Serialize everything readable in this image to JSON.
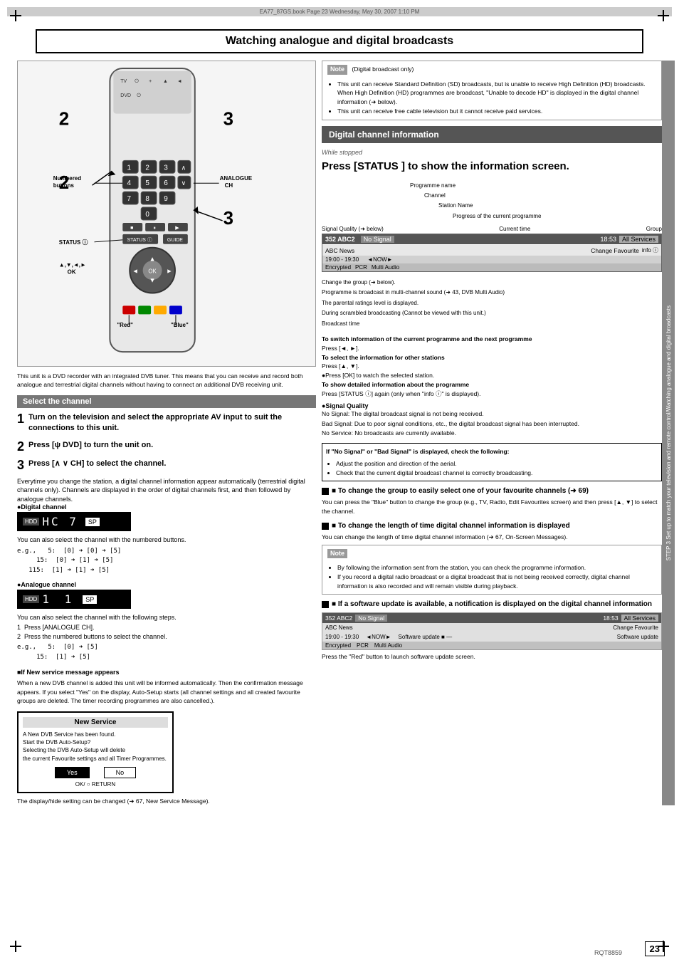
{
  "page": {
    "title": "Watching analogue and digital broadcasts",
    "header_bar": "EA77_87GS.book  Page 23  Wednesday, May 30, 2007  1:10 PM",
    "page_number": "23",
    "rqt": "RQT8859"
  },
  "sidebar": {
    "text": "STEP 3  Set up to match your television and remote control/Watching analogue and digital broadcasts"
  },
  "note_box": {
    "label": "Note",
    "parenthetical": "(Digital broadcast only)",
    "items": [
      "This unit can receive Standard Definition (SD) broadcasts, but is unable to receive High Definition (HD) broadcasts. When High Definition (HD) programmes are broadcast, \"Unable to decode HD\" is displayed in the digital channel information (➜ below).",
      "This unit can receive free cable television but it cannot receive paid services."
    ]
  },
  "digital_info": {
    "header": "Digital channel information",
    "subhead": "While stopped",
    "press_text": "Press [STATUS  ] to show the information screen.",
    "annotations": [
      "Programme name",
      "Channel",
      "Station Name",
      "Progress of the current programme",
      "Signal Quality (➜ below)",
      "Current time",
      "Group",
      "Change the group (➜ below).",
      "Programme is broadcast in multi-channel sound (➜ 43, DVB Multi Audio)",
      "The parental ratings level is displayed.",
      "During scrambled broadcasting (Cannot be viewed with this unit.)",
      "Broadcast time"
    ],
    "prog_display": {
      "row1": {
        "ch": "352 ABC2",
        "nosignal": "No Signal",
        "time": "18:53",
        "allservices": "All Services"
      },
      "row2": {
        "name": "ABC News",
        "changefav": "Change Favourite",
        "now": "◄NOW►",
        "info": "info ⓘ"
      },
      "row3": {
        "time": "19:00 - 19:30",
        "extra": "◄ NOW ►",
        "softwareupdate": ""
      },
      "row4": {
        "label": "Encrypted",
        "pcr": "PCR",
        "multiaudio": "Multi Audio"
      }
    }
  },
  "select_channel": {
    "header": "Select the channel",
    "steps": [
      {
        "num": "1",
        "text": "Turn on the television and select the appropriate AV input to suit the connections to this unit."
      },
      {
        "num": "2",
        "text": "Press [ψ DVD] to turn the unit on.",
        "bold": true
      },
      {
        "num": "3",
        "text": "Press [∧  ∨  CH] to select the channel.",
        "bold": true
      }
    ],
    "subtext": "Everytime you change the station, a digital channel information appear automatically (terrestrial digital channels only). Channels are displayed in the order of digital channels first, and then followed by analogue channels.",
    "digital_channel": {
      "label": "●Digital channel",
      "display": "HC 7",
      "hdd": "HDD",
      "sp": "SP"
    },
    "numbered_buttons_note": "You can also select the channel with the numbered buttons.",
    "examples": [
      "e.g.,   5:  [0] ➜ [0] ➜ [5]",
      "      15:  [0] ➜ [1] ➜ [5]",
      "    115:  [1] ➜ [1] ➜ [5]"
    ],
    "analogue_channel": {
      "label": "●Analogue channel",
      "display": "1  1",
      "hdd": "HDD",
      "sp": "SP"
    },
    "analogue_steps": [
      "1  Press [ANALOGUE CH].",
      "2  Press the numbered buttons to select the channel.",
      "e.g.,   5:  [0] ➜ [5]",
      "      15:  [1] ➜ [5]"
    ]
  },
  "new_service": {
    "title": "New Service",
    "lines": [
      "A New DVB Service has been found.",
      "Start the DVB Auto-Setup?",
      "Selecting the DVB Auto-Setup will delete",
      "the current Favourite settings and all Timer Programmes."
    ],
    "yes_label": "Yes",
    "no_label": "No",
    "bottom": "OK/      ○ RETURN"
  },
  "new_service_caption": "The display/hide setting can be changed (➜ 67, New Service Message).",
  "new_service_sub": "■If New service message appears",
  "new_service_desc": "When a new DVB channel is added this unit will be informed automatically. Then the confirmation message appears. If you select \"Yes\" on the display, Auto-Setup starts (all channel settings and all created favourite groups are deleted. The timer recording programmes are also cancelled.).",
  "switch_info": {
    "header": "To switch information of the current programme and the next programme",
    "text": "Press [◄, ►].",
    "select_info_head": "To select the information for other stations",
    "select_info_text": "Press [▲, ▼].",
    "ok_text": "●Press [OK] to watch the selected station.",
    "detailed_head": "To show detailed information about the programme",
    "detailed_text": "Press [STATUS ⓘ] again (only when \"info ⓘ\" is displayed)."
  },
  "signal_quality": {
    "header": "●Signal Quality",
    "no_signal": "No Signal:  The digital broadcast signal is not being received.",
    "bad_signal": "Bad Signal: Due to poor signal conditions, etc., the digital broadcast signal has been interrupted.",
    "no_service": "No Service: No broadcasts are currently available."
  },
  "warning_box": {
    "header": "If \"No Signal\" or \"Bad Signal\" is displayed, check the following:",
    "items": [
      "Adjust the position and direction of the aerial.",
      "Check that the current digital broadcast channel is correctly broadcasting."
    ]
  },
  "change_group": {
    "header": "■ To change the group to easily select one of your favourite channels (➜ 69)",
    "text": "You can press the \"Blue\" button to change the group (e.g., TV, Radio, Edit Favourites screen) and then press [▲, ▼] to select the channel."
  },
  "change_length": {
    "header": "■ To change the length of time digital channel information is displayed",
    "text": "You can change the length of time digital channel information (➜ 67, On-Screen Messages).",
    "note_label": "Note",
    "note_items": [
      "By following the information sent from the station, you can check the programme information.",
      "If you record a digital radio broadcast or a digital broadcast that is not being received correctly, digital channel information is also recorded and will remain visible during playback."
    ]
  },
  "software_update": {
    "header": "■ If a software update is available, a notification is displayed on the digital channel information",
    "row1": {
      "ch": "352 ABC2",
      "nosignal": "No Signal",
      "time": "18:53",
      "allservices": "All Services"
    },
    "row2": {
      "name": "ABC News",
      "changefav": "Change Favourite",
      "extra": "■"
    },
    "row3": {
      "time": "19:00 - 19:30",
      "now": "◄NOW►",
      "update": "Software update ■ —",
      "label": "Software update"
    },
    "row4": {
      "label": "Encrypted",
      "pcr": "PCR",
      "multiaudio": "Multi Audio"
    },
    "caption": "Press the \"Red\" button to launch software update screen."
  },
  "remote": {
    "step2_label": "2",
    "step3_label": "3",
    "step2_left_label": "2",
    "step3_left_label": "3",
    "numbered_buttons": "Numbered\nbuttons",
    "analogue_ch": "ANALOGUE\nCH",
    "status": "STATUS ⓘ",
    "ok": "OK",
    "red": "\"Red\"",
    "blue": "\"Blue\"",
    "nav": "▲,▼,◄,►\nOK"
  }
}
